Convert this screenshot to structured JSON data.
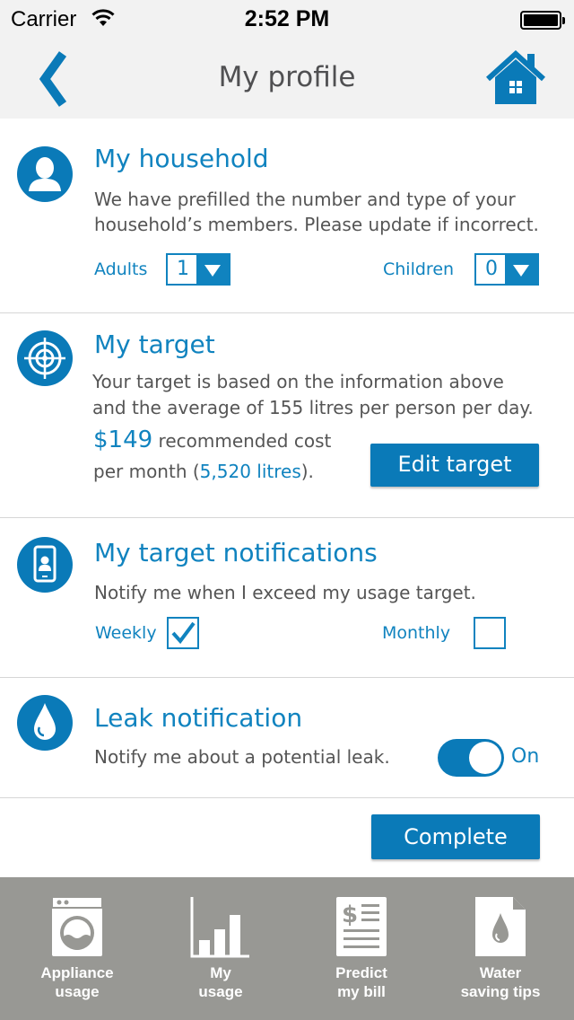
{
  "status_bar": {
    "carrier": "Carrier",
    "time": "2:52 PM"
  },
  "nav": {
    "title": "My profile",
    "back_icon": "chevron-left-icon",
    "home_icon": "home-icon"
  },
  "household": {
    "title": "My household",
    "line1": "We have prefilled the number and type of your",
    "line2": "household’s members. Please update if incorrect.",
    "adults_label": "Adults",
    "adults_value": "1",
    "children_label": "Children",
    "children_value": "0"
  },
  "target": {
    "title": "My target",
    "line1": "Your target is based on the information above",
    "line2": "and  the average of 155 litres per person per day.",
    "amount": "$149",
    "amount_suffix": " recommended cost",
    "per_month": "per month (",
    "litres": "5,520 litres",
    "per_month_end": ").",
    "edit_button": "Edit target"
  },
  "notifications": {
    "title": "My target notifications",
    "line1": "Notify me when I exceed my usage target.",
    "weekly_label": "Weekly",
    "weekly_checked": true,
    "monthly_label": "Monthly",
    "monthly_checked": false
  },
  "leak": {
    "title": "Leak notification",
    "line1": "Notify me about a potential leak.",
    "toggle_label": "On",
    "toggle_on": true
  },
  "complete_button": "Complete",
  "tabs": [
    {
      "line1": "Appliance",
      "line2": "usage",
      "icon": "washing-machine-icon"
    },
    {
      "line1": "My",
      "line2": "usage",
      "icon": "bar-chart-icon"
    },
    {
      "line1": "Predict",
      "line2": "my bill",
      "icon": "bill-icon"
    },
    {
      "line1": "Water",
      "line2": "saving tips",
      "icon": "water-tips-icon"
    }
  ],
  "colors": {
    "accent": "#0a7ab8",
    "text_blue": "#1083bf",
    "tabbar": "#989894",
    "header_bg": "#f2f2f2"
  }
}
